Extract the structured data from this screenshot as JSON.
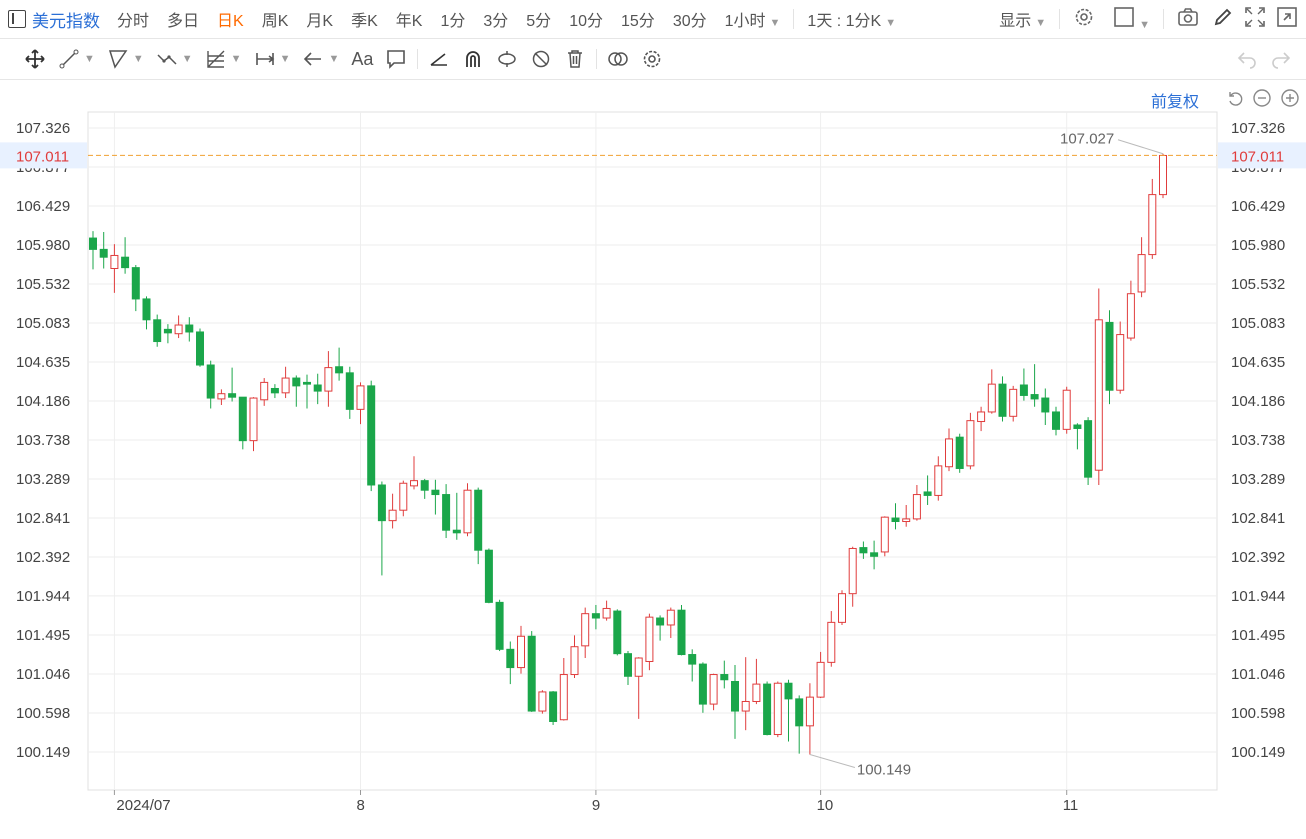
{
  "toolbar": {
    "title": "美元指数",
    "periods": [
      "分时",
      "多日",
      "日K",
      "周K",
      "月K",
      "季K",
      "年K",
      "1分",
      "3分",
      "5分",
      "10分",
      "15分",
      "30分"
    ],
    "active_period": "日K",
    "hour_select": "1小时",
    "range_select": "1天 : 1分K",
    "display_label": "显示"
  },
  "adjust_label": "前复权",
  "colors": {
    "up": "#e03c3c",
    "down": "#1aa64a",
    "accent": "#ff6a00",
    "link": "#2b6fd6",
    "price_line": "#f0a030"
  },
  "chart_data": {
    "type": "candlestick",
    "y_ticks": [
      "107.326",
      "106.877",
      "106.429",
      "105.980",
      "105.532",
      "105.083",
      "104.635",
      "104.186",
      "103.738",
      "103.289",
      "102.841",
      "102.392",
      "101.944",
      "101.495",
      "101.046",
      "100.598",
      "100.149"
    ],
    "ylim": [
      99.7,
      107.5
    ],
    "x_labels": [
      {
        "label": "2024/07",
        "index": 2
      },
      {
        "label": "8",
        "index": 25
      },
      {
        "label": "9",
        "index": 47
      },
      {
        "label": "10",
        "index": 68
      },
      {
        "label": "11",
        "index": 91
      }
    ],
    "current_price": "107.011",
    "max_label": "107.027",
    "min_label": "100.149",
    "candles": [
      [
        106.06,
        105.93,
        106.14,
        105.7
      ],
      [
        105.93,
        105.84,
        106.13,
        105.71
      ],
      [
        105.71,
        105.86,
        105.99,
        105.43
      ],
      [
        105.84,
        105.72,
        106.07,
        105.65
      ],
      [
        105.72,
        105.36,
        105.75,
        105.22
      ],
      [
        105.36,
        105.12,
        105.39,
        105.01
      ],
      [
        105.12,
        104.87,
        105.18,
        104.81
      ],
      [
        105.01,
        104.97,
        105.07,
        104.85
      ],
      [
        104.96,
        105.06,
        105.17,
        104.91
      ],
      [
        105.06,
        104.98,
        105.15,
        104.87
      ],
      [
        104.98,
        104.6,
        105.02,
        104.58
      ],
      [
        104.6,
        104.22,
        104.65,
        104.1
      ],
      [
        104.21,
        104.27,
        104.32,
        104.14
      ],
      [
        104.27,
        104.23,
        104.57,
        104.18
      ],
      [
        104.23,
        103.73,
        104.23,
        103.63
      ],
      [
        103.73,
        104.22,
        104.23,
        103.61
      ],
      [
        104.2,
        104.4,
        104.45,
        104.13
      ],
      [
        104.33,
        104.28,
        104.38,
        104.22
      ],
      [
        104.28,
        104.45,
        104.58,
        104.22
      ],
      [
        104.45,
        104.36,
        104.48,
        104.12
      ],
      [
        104.4,
        104.38,
        104.49,
        104.1
      ],
      [
        104.37,
        104.3,
        104.5,
        104.15
      ],
      [
        104.3,
        104.57,
        104.76,
        104.12
      ],
      [
        104.58,
        104.51,
        104.8,
        104.42
      ],
      [
        104.51,
        104.09,
        104.58,
        103.98
      ],
      [
        104.09,
        104.36,
        104.4,
        103.92
      ],
      [
        104.36,
        103.22,
        104.42,
        103.15
      ],
      [
        103.22,
        102.81,
        103.26,
        102.18
      ],
      [
        102.81,
        102.93,
        103.12,
        102.72
      ],
      [
        102.93,
        103.24,
        103.27,
        102.86
      ],
      [
        103.21,
        103.27,
        103.55,
        103.17
      ],
      [
        103.27,
        103.16,
        103.29,
        103.06
      ],
      [
        103.16,
        103.11,
        103.28,
        102.88
      ],
      [
        103.11,
        102.7,
        103.23,
        102.61
      ],
      [
        102.7,
        102.67,
        103.13,
        102.59
      ],
      [
        102.67,
        103.16,
        103.24,
        102.63
      ],
      [
        103.16,
        102.47,
        103.19,
        102.31
      ],
      [
        102.47,
        101.87,
        102.49,
        101.86
      ],
      [
        101.87,
        101.33,
        101.9,
        101.31
      ],
      [
        101.33,
        101.12,
        101.42,
        100.93
      ],
      [
        101.12,
        101.48,
        101.6,
        101.05
      ],
      [
        101.48,
        100.62,
        101.54,
        100.61
      ],
      [
        100.62,
        100.84,
        100.86,
        100.59
      ],
      [
        100.84,
        100.5,
        100.85,
        100.46
      ],
      [
        100.52,
        101.04,
        101.23,
        100.51
      ],
      [
        101.04,
        101.36,
        101.49,
        101.0
      ],
      [
        101.37,
        101.74,
        101.81,
        101.23
      ],
      [
        101.74,
        101.69,
        101.84,
        101.56
      ],
      [
        101.69,
        101.8,
        101.89,
        101.66
      ],
      [
        101.77,
        101.28,
        101.79,
        101.26
      ],
      [
        101.28,
        101.02,
        101.31,
        100.92
      ],
      [
        101.02,
        101.23,
        101.24,
        100.53
      ],
      [
        101.19,
        101.7,
        101.74,
        101.09
      ],
      [
        101.69,
        101.61,
        101.72,
        101.43
      ],
      [
        101.61,
        101.78,
        101.81,
        101.46
      ],
      [
        101.78,
        101.27,
        101.84,
        101.26
      ],
      [
        101.27,
        101.16,
        101.33,
        100.96
      ],
      [
        101.16,
        100.7,
        101.18,
        100.6
      ],
      [
        100.7,
        101.04,
        101.05,
        100.63
      ],
      [
        101.04,
        100.98,
        101.2,
        100.88
      ],
      [
        100.96,
        100.62,
        101.15,
        100.3
      ],
      [
        100.62,
        100.73,
        101.24,
        100.4
      ],
      [
        100.73,
        100.93,
        101.22,
        100.7
      ],
      [
        100.93,
        100.35,
        100.96,
        100.34
      ],
      [
        100.35,
        100.94,
        100.96,
        100.32
      ],
      [
        100.94,
        100.76,
        100.98,
        100.27
      ],
      [
        100.76,
        100.45,
        100.8,
        100.13
      ],
      [
        100.45,
        100.78,
        100.94,
        100.12
      ],
      [
        100.78,
        101.18,
        101.3,
        100.77
      ],
      [
        101.18,
        101.64,
        101.77,
        101.13
      ],
      [
        101.64,
        101.97,
        102.01,
        101.61
      ],
      [
        101.97,
        102.49,
        102.51,
        101.82
      ],
      [
        102.5,
        102.44,
        102.57,
        102.37
      ],
      [
        102.44,
        102.4,
        102.58,
        102.25
      ],
      [
        102.45,
        102.85,
        102.86,
        102.4
      ],
      [
        102.84,
        102.8,
        103.01,
        102.71
      ],
      [
        102.8,
        102.83,
        102.99,
        102.74
      ],
      [
        102.83,
        103.11,
        103.22,
        102.81
      ],
      [
        103.14,
        103.1,
        103.33,
        102.99
      ],
      [
        103.1,
        103.44,
        103.55,
        103.04
      ],
      [
        103.43,
        103.75,
        103.87,
        103.38
      ],
      [
        103.77,
        103.41,
        103.81,
        103.36
      ],
      [
        103.44,
        103.96,
        104.05,
        103.4
      ],
      [
        103.95,
        104.06,
        104.12,
        103.84
      ],
      [
        104.06,
        104.38,
        104.55,
        104.04
      ],
      [
        104.38,
        104.01,
        104.47,
        103.95
      ],
      [
        104.01,
        104.32,
        104.36,
        103.95
      ],
      [
        104.37,
        104.25,
        104.56,
        104.19
      ],
      [
        104.26,
        104.21,
        104.61,
        104.12
      ],
      [
        104.22,
        104.06,
        104.33,
        103.91
      ],
      [
        104.06,
        103.86,
        104.12,
        103.79
      ],
      [
        103.86,
        104.31,
        104.35,
        103.81
      ],
      [
        103.91,
        103.87,
        103.93,
        103.63
      ],
      [
        103.96,
        103.31,
        104.0,
        103.22
      ],
      [
        103.39,
        105.12,
        105.48,
        103.22
      ],
      [
        105.09,
        104.31,
        105.23,
        104.15
      ],
      [
        104.31,
        104.95,
        105.1,
        104.27
      ],
      [
        104.91,
        105.42,
        105.57,
        104.88
      ],
      [
        105.44,
        105.87,
        106.07,
        105.38
      ],
      [
        105.87,
        106.56,
        106.74,
        105.82
      ],
      [
        106.56,
        107.01,
        107.03,
        106.52
      ]
    ]
  }
}
